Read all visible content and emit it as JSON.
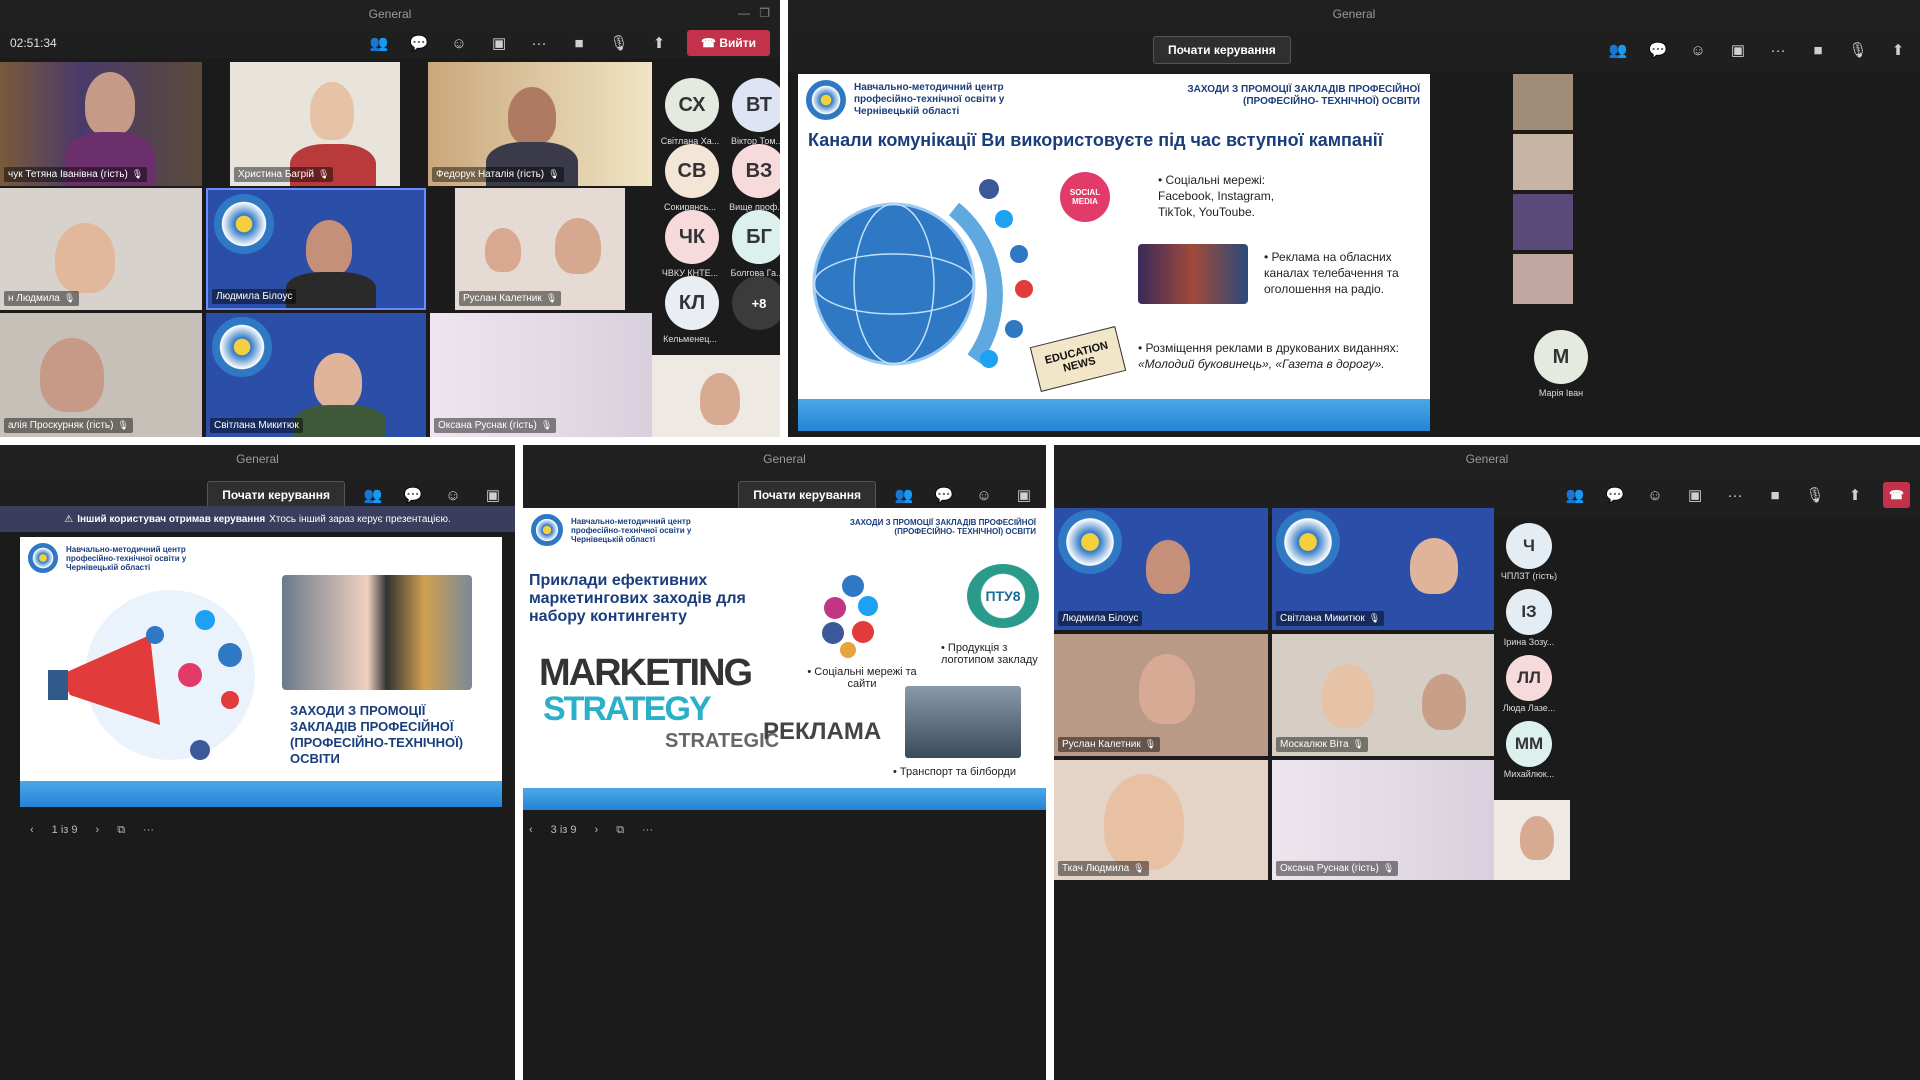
{
  "top_left": {
    "title": "General",
    "timer": "02:51:34",
    "leave_label": "Вийти",
    "tiles": [
      {
        "name": "чук Тетяна Іванівна (гість)"
      },
      {
        "name": "Христина Багрій"
      },
      {
        "name": "Федорук Наталія (гість)"
      },
      {
        "name": "н Людмила"
      },
      {
        "name": "Людмила Білоус"
      },
      {
        "name": "Руслан Калетник"
      },
      {
        "name": "алія Проскурняк (гість)"
      },
      {
        "name": "Світлана Микитюк"
      },
      {
        "name": "Оксана Руснак (гість)"
      }
    ],
    "avatars": [
      {
        "initials": "СХ",
        "label": "Світлана Ха...",
        "color": "#e4eadf"
      },
      {
        "initials": "ВТ",
        "label": "Віктор Том...",
        "color": "#dfe4f4"
      },
      {
        "initials": "СВ",
        "label": "Сокирянсь...",
        "color": "#f4e6d6"
      },
      {
        "initials": "ВЗ",
        "label": "Вище проф...",
        "color": "#f6dadc"
      },
      {
        "initials": "ЧК",
        "label": "ЧВКУ КНТЕ...",
        "color": "#f6dadc"
      },
      {
        "initials": "БГ",
        "label": "Болгова Га...",
        "color": "#dcf1ee"
      },
      {
        "initials": "КЛ",
        "label": "Кельменец...",
        "color": "#e8eef4"
      },
      {
        "initials": "+8",
        "label": "",
        "color": "#3b3b3b"
      }
    ]
  },
  "top_right": {
    "title": "General",
    "control_label": "Почати керування",
    "slide": {
      "org": "Навчально-методичний центр професійно-технічної освіти у Чернівецькій області",
      "header_right": "ЗАХОДИ З ПРОМОЦІЇ ЗАКЛАДІВ ПРОФЕСІЙНОЇ (ПРОФЕСІЙНО- ТЕХНІЧНОЇ) ОСВІТИ",
      "heading": "Канали комунікації Ви використовуєте під час вступної кампанії",
      "bullet1": "Соціальні мережі: Facebook, Instagram, TikTok, YouToube.",
      "bullet2": "Реклама на обласних каналах телебачення та оголошення на радіо.",
      "bullet3_a": "Розміщення реклами в друкованих виданнях:",
      "bullet3_b": "«Молодий буковинець», «Газета в дорогу».",
      "social_badge": "SOCIAL MEDIA",
      "news_badge": "EDUCATION NEWS"
    },
    "side_avatar": {
      "initials": "М",
      "label": "Марія Іван"
    }
  },
  "bottom_left": {
    "title": "General",
    "control_label": "Почати керування",
    "warning_bold": "Інший користувач отримав керування",
    "warning_text": "Хтось інший зараз керує презентацією.",
    "slide": {
      "org": "Навчально-методичний центр професійно-технічної освіти у Чернівецькій області",
      "heading": "ЗАХОДИ З ПРОМОЦІЇ ЗАКЛАДІВ ПРОФЕСІЙНОЇ (ПРОФЕСІЙНО-ТЕХНІЧНОЇ) ОСВІТИ"
    },
    "page": "1 із 9"
  },
  "bottom_mid": {
    "title": "General",
    "control_label": "Почати керування",
    "slide": {
      "org": "Навчально-методичний центр професійно-технічної освіти у Чернівецькій області",
      "header_right": "ЗАХОДИ З ПРОМОЦІЇ ЗАКЛАДІВ ПРОФЕСІЙНОЇ (ПРОФЕСІЙНО- ТЕХНІЧНОЇ) ОСВІТИ",
      "heading": "Приклади ефективних маркетингових заходів для набору контингенту",
      "social": "Соціальні мережі та сайти",
      "products": "Продукція з логотипом закладу",
      "transport": "Транспорт та білборди",
      "ad_word": "РЕКЛАМА",
      "logo_text": "ПТУ8",
      "cloud_marketing": "MARKETING",
      "cloud_strategy": "STRATEGY",
      "cloud_strategic": "STRATEGIC"
    },
    "page": "3 із 9"
  },
  "bottom_right": {
    "title": "General",
    "tiles": [
      {
        "name": "Людмила Білоус"
      },
      {
        "name": "Світлана Микитюк"
      },
      {
        "name": "Руслан Калетник"
      },
      {
        "name": "Москалюк Віта"
      },
      {
        "name": "Ткач Людмила"
      },
      {
        "name": "Оксана Руснак (гість)"
      }
    ],
    "avatars": [
      {
        "initials": "Ч",
        "label": "ЧПЛЗТ (гість)",
        "color": "#e4ecf4"
      },
      {
        "initials": "ІЗ",
        "label": "Ірина Зозу...",
        "color": "#e4ecf4"
      },
      {
        "initials": "ЛЛ",
        "label": "Люда Лазе...",
        "color": "#f6dadc"
      },
      {
        "initials": "ММ",
        "label": "Михайлюк...",
        "color": "#dcf1ee"
      }
    ]
  },
  "colors": {
    "accent": "#c4314b",
    "slide_blue": "#1a3d7c",
    "bar": "#2583d6"
  }
}
